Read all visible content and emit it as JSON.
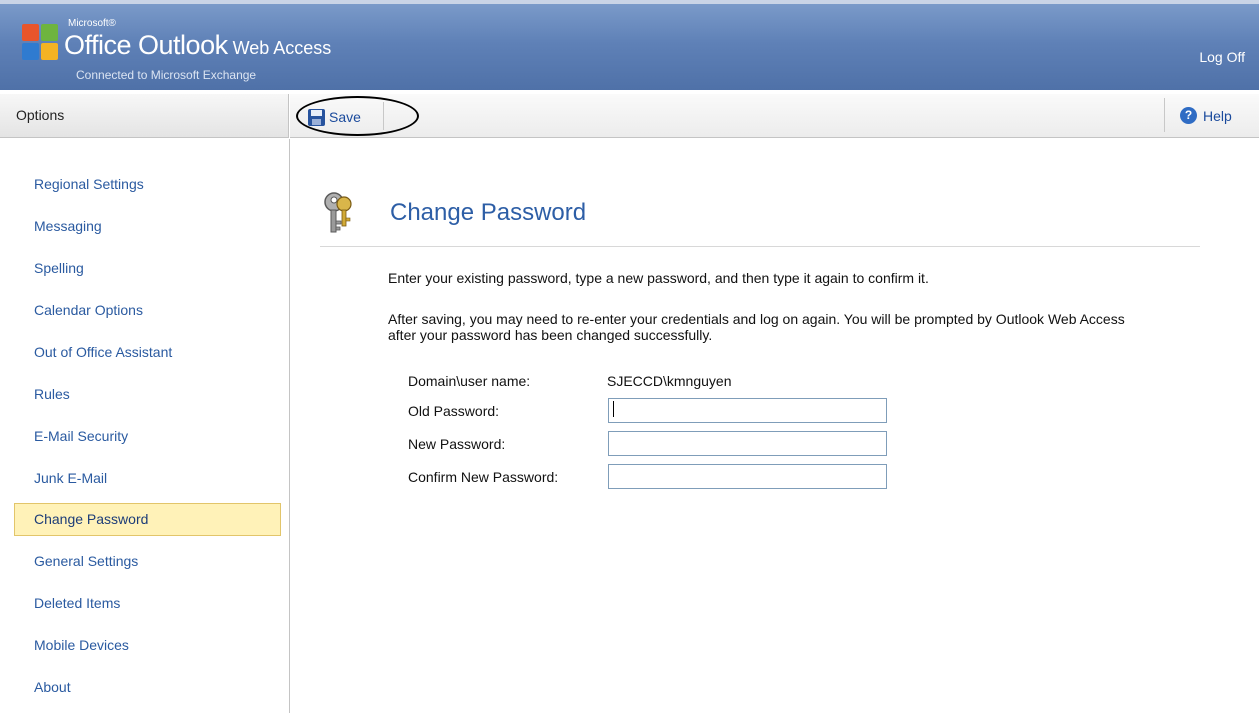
{
  "header": {
    "brand_small": "Microsoft®",
    "brand_title": "Office Outlook",
    "brand_suffix": " Web Access",
    "subtitle": "Connected to Microsoft Exchange",
    "logoff_label": "Log Off"
  },
  "options_bar": {
    "label": "Options"
  },
  "toolbar": {
    "save_label": "Save",
    "help_label": "Help"
  },
  "sidebar": {
    "items": [
      {
        "label": "Regional Settings"
      },
      {
        "label": "Messaging"
      },
      {
        "label": "Spelling"
      },
      {
        "label": "Calendar Options"
      },
      {
        "label": "Out of Office Assistant"
      },
      {
        "label": "Rules"
      },
      {
        "label": "E-Mail Security"
      },
      {
        "label": "Junk E-Mail"
      },
      {
        "label": "Change Password"
      },
      {
        "label": "General Settings"
      },
      {
        "label": "Deleted Items"
      },
      {
        "label": "Mobile Devices"
      },
      {
        "label": "About"
      }
    ],
    "selected": "Change Password"
  },
  "main": {
    "title": "Change Password",
    "instruction": "Enter your existing password, type a new password, and then type it again to confirm it.",
    "note": "After saving, you may need to re-enter your credentials and log on again. You will be prompted by Outlook Web Access after your password has been changed successfully.",
    "form": {
      "domain_label": "Domain\\user name:",
      "domain_value": "SJECCD\\kmnguyen",
      "old_label": "Old Password:",
      "old_value": "",
      "new_label": "New Password:",
      "new_value": "",
      "confirm_label": "Confirm New Password:",
      "confirm_value": ""
    }
  },
  "colors": {
    "header_bg": "#5f81b7",
    "link": "#2a5aa0",
    "title": "#2d5ea6",
    "selected_bg": "#fff2b8",
    "selected_border": "#e2c56a"
  },
  "icons": {
    "logo": "office-logo-icon",
    "save": "floppy-disk-icon",
    "help": "question-circle-icon",
    "page": "keys-icon"
  }
}
